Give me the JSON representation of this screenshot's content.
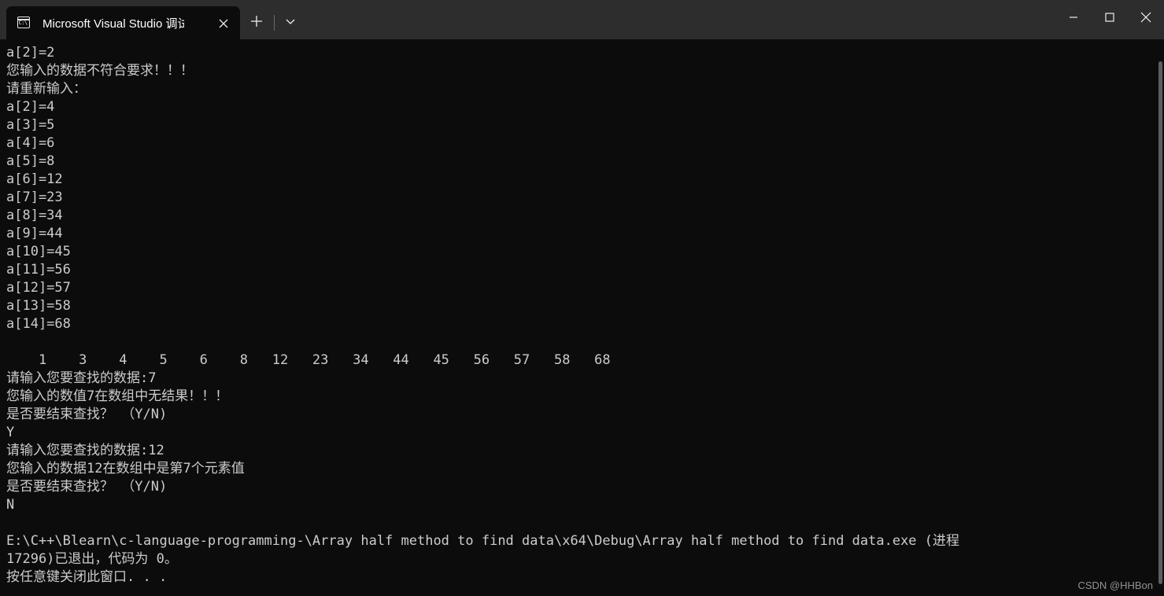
{
  "window": {
    "tab": {
      "icon": "command-prompt-icon",
      "icon_glyph": "C:\\",
      "title": "Microsoft Visual Studio 调试控",
      "close_icon": "close-icon"
    },
    "new_tab_icon": "plus-icon",
    "tab_dropdown_icon": "chevron-down-icon",
    "controls": {
      "minimize": "minimize-icon",
      "maximize": "maximize-icon",
      "close": "close-icon"
    },
    "colors": {
      "titlebar_bg": "#2d2d2d",
      "terminal_bg": "#0c0c0c",
      "text": "#cccccc",
      "scrollbar_thumb": "#7a7a7a"
    }
  },
  "terminal": {
    "lines": [
      "a[2]=2",
      "您输入的数据不符合要求！！！",
      "请重新输入：",
      "a[2]=4",
      "a[3]=5",
      "a[4]=6",
      "a[5]=8",
      "a[6]=12",
      "a[7]=23",
      "a[8]=34",
      "a[9]=44",
      "a[10]=45",
      "a[11]=56",
      "a[12]=57",
      "a[13]=58",
      "a[14]=68",
      "",
      "    1    3    4    5    6    8   12   23   34   44   45   56   57   58   68",
      "请输入您要查找的数据:7",
      "您输入的数值7在数组中无结果！！！",
      "是否要结束查找？ （Y/N)",
      "Y",
      "请输入您要查找的数据:12",
      "您输入的数据12在数组中是第7个元素值",
      "是否要结束查找？ （Y/N)",
      "N",
      "",
      "E:\\C++\\Blearn\\c-language-programming-\\Array half method to find data\\x64\\Debug\\Array half method to find data.exe (进程",
      "17296)已退出，代码为 0。",
      "按任意键关闭此窗口. . ."
    ],
    "array_values": [
      1,
      3,
      4,
      5,
      6,
      8,
      12,
      23,
      34,
      44,
      45,
      56,
      57,
      58,
      68
    ],
    "entered_values": [
      {
        "index": "a[2]",
        "value": "2"
      },
      {
        "index": "a[2]",
        "value": "4"
      },
      {
        "index": "a[3]",
        "value": "5"
      },
      {
        "index": "a[4]",
        "value": "6"
      },
      {
        "index": "a[5]",
        "value": "8"
      },
      {
        "index": "a[6]",
        "value": "12"
      },
      {
        "index": "a[7]",
        "value": "23"
      },
      {
        "index": "a[8]",
        "value": "34"
      },
      {
        "index": "a[9]",
        "value": "44"
      },
      {
        "index": "a[10]",
        "value": "45"
      },
      {
        "index": "a[11]",
        "value": "56"
      },
      {
        "index": "a[12]",
        "value": "57"
      },
      {
        "index": "a[13]",
        "value": "58"
      },
      {
        "index": "a[14]",
        "value": "68"
      }
    ],
    "searches": [
      {
        "query": "7",
        "result": "您输入的数值7在数组中无结果！！！",
        "answer": "Y"
      },
      {
        "query": "12",
        "result": "您输入的数据12在数组中是第7个元素值",
        "answer": "N"
      }
    ],
    "exit": {
      "executable_path": "E:\\C++\\Blearn\\c-language-programming-\\Array half method to find data\\x64\\Debug\\Array half method to find data.exe",
      "process_id": "17296",
      "exit_code": "0",
      "prompt": "按任意键关闭此窗口. . ."
    }
  },
  "watermark": "CSDN @HHBon"
}
